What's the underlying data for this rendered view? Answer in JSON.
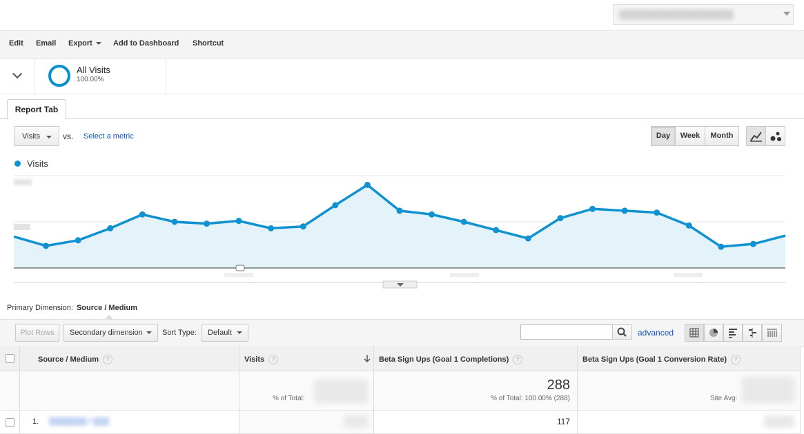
{
  "toolbar": {
    "edit": "Edit",
    "email": "Email",
    "export": "Export",
    "add_to_dashboard": "Add to Dashboard",
    "shortcut": "Shortcut"
  },
  "segment": {
    "name": "All Visits",
    "percent": "100.00%"
  },
  "tab": {
    "label": "Report Tab"
  },
  "chart_controls": {
    "metric": "Visits",
    "vs": "vs.",
    "select_metric": "Select a metric",
    "granularity": [
      "Day",
      "Week",
      "Month"
    ],
    "selected_granularity": "Day"
  },
  "chart_data": {
    "type": "area",
    "series": [
      {
        "name": "Visits",
        "color": "#1192d0",
        "values": [
          0.34,
          0.24,
          0.3,
          0.43,
          0.58,
          0.5,
          0.48,
          0.51,
          0.43,
          0.45,
          0.68,
          0.9,
          0.62,
          0.58,
          0.5,
          0.41,
          0.32,
          0.54,
          0.64,
          0.62,
          0.6,
          0.46,
          0.23,
          0.26,
          0.35
        ]
      }
    ],
    "values_note": "",
    "grid": true,
    "legend": "top-left"
  },
  "primary_dimension": {
    "label": "Primary Dimension:",
    "value": "Source / Medium"
  },
  "table_toolbar": {
    "plot_rows": "Plot Rows",
    "secondary_dimension": "Secondary dimension",
    "sort_label": "Sort Type:",
    "sort_value": "Default",
    "advanced": "advanced",
    "search_placeholder": ""
  },
  "table": {
    "columns": [
      "Source / Medium",
      "Visits",
      "Beta Sign Ups (Goal 1 Completions)",
      "Beta Sign Ups (Goal 1 Conversion Rate)"
    ],
    "totals": {
      "visits_label": "% of Total:",
      "completions_value": "288",
      "completions_sub": "% of Total: 100.00% (288)",
      "rate_label": "Site Avg:"
    },
    "rows": [
      {
        "index": "1.",
        "completions": "117"
      }
    ]
  }
}
